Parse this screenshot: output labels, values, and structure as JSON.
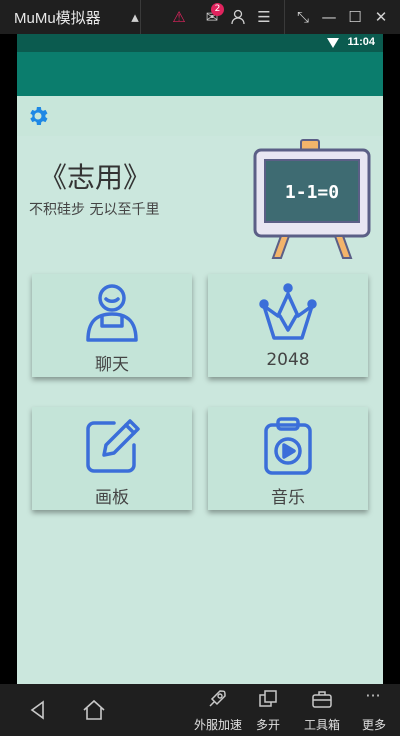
{
  "emulator": {
    "title": "MuMu模拟器",
    "mail_badge": "2",
    "bottom_actions": [
      "外服加速",
      "多开",
      "工具箱",
      "更多"
    ]
  },
  "statusbar": {
    "time": "11:04"
  },
  "app": {
    "header_title": "《志用》",
    "header_subtitle": "不积硅步 无以至千里",
    "blackboard_text": "1-1=0",
    "cards": [
      {
        "label": "聊天",
        "icon": "person-icon"
      },
      {
        "label": "2048",
        "icon": "crown-icon"
      },
      {
        "label": "画板",
        "icon": "pencil-edit-icon"
      },
      {
        "label": "音乐",
        "icon": "music-player-icon"
      }
    ]
  },
  "colors": {
    "screen_bg": "#cbe7dd",
    "appbar": "#0b7d6d",
    "statusbar": "#0b5b4f",
    "icon_blue": "#3b6ed9",
    "gear_blue": "#1e88e5"
  }
}
